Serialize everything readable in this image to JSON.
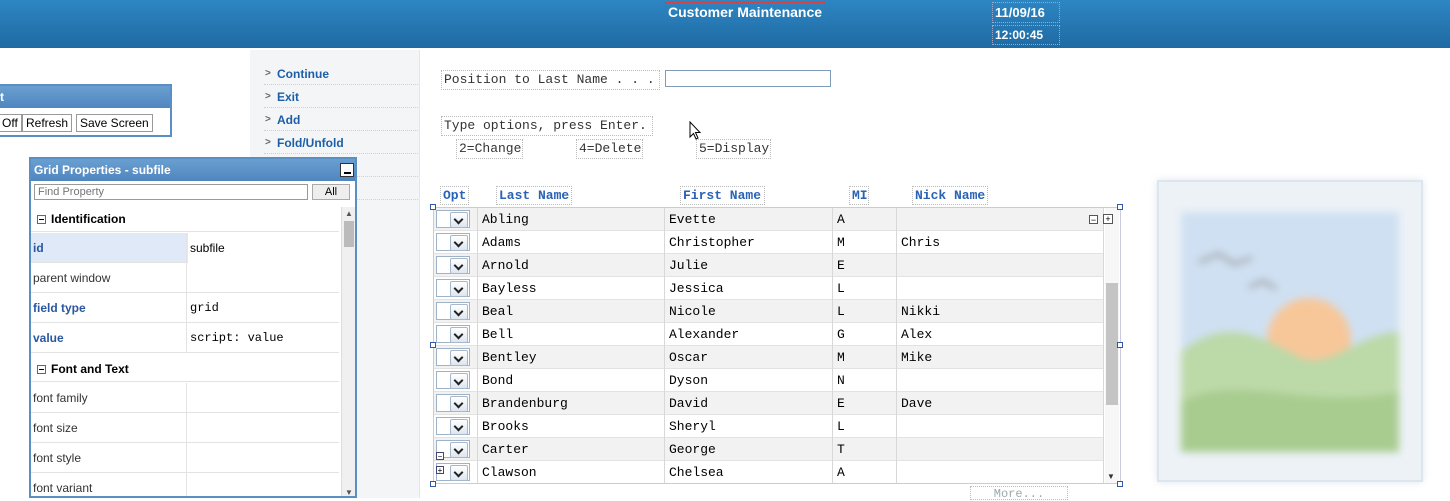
{
  "header": {
    "title": "Customer Maintenance",
    "date": "11/09/16",
    "time": "12:00:45"
  },
  "menu": {
    "items": [
      "Continue",
      "Exit",
      "Add",
      "Fold/Unfold"
    ]
  },
  "toolbar": {
    "title": "t",
    "buttons": [
      "Off",
      "Refresh",
      "Save Screen"
    ]
  },
  "grid_properties": {
    "title": "Grid Properties - subfile",
    "search_placeholder": "Find Property",
    "all_label": "All",
    "sections": [
      {
        "title": "Identification",
        "rows": [
          {
            "name": "id",
            "value": "subfile"
          },
          {
            "name": "parent window",
            "value": ""
          },
          {
            "name": "field type",
            "value": "grid"
          },
          {
            "name": "value",
            "value": "script: value"
          }
        ]
      },
      {
        "title": "Font and Text",
        "rows": [
          {
            "name": "font family",
            "value": ""
          },
          {
            "name": "font size",
            "value": ""
          },
          {
            "name": "font style",
            "value": ""
          },
          {
            "name": "font variant",
            "value": ""
          }
        ]
      }
    ]
  },
  "form": {
    "position_label": "Position to Last Name . . .",
    "position_value": "",
    "instructions": "Type options, press Enter.",
    "options": [
      "2=Change",
      "4=Delete",
      "5=Display"
    ],
    "columns": [
      "Opt",
      "Last Name",
      "First Name",
      "MI",
      "Nick Name"
    ],
    "rows": [
      {
        "last": "Abling",
        "first": "Evette",
        "mi": "A",
        "nick": ""
      },
      {
        "last": "Adams",
        "first": "Christopher",
        "mi": "M",
        "nick": "Chris"
      },
      {
        "last": "Arnold",
        "first": "Julie",
        "mi": "E",
        "nick": ""
      },
      {
        "last": "Bayless",
        "first": "Jessica",
        "mi": "L",
        "nick": ""
      },
      {
        "last": "Beal",
        "first": "Nicole",
        "mi": "L",
        "nick": "Nikki"
      },
      {
        "last": "Bell",
        "first": "Alexander",
        "mi": "G",
        "nick": "Alex"
      },
      {
        "last": "Bentley",
        "first": "Oscar",
        "mi": "M",
        "nick": "Mike"
      },
      {
        "last": "Bond",
        "first": "Dyson",
        "mi": "N",
        "nick": ""
      },
      {
        "last": "Brandenburg",
        "first": "David",
        "mi": "E",
        "nick": "Dave"
      },
      {
        "last": "Brooks",
        "first": "Sheryl",
        "mi": "L",
        "nick": ""
      },
      {
        "last": "Carter",
        "first": "George",
        "mi": "T",
        "nick": ""
      },
      {
        "last": "Clawson",
        "first": "Chelsea",
        "mi": "A",
        "nick": ""
      }
    ],
    "more_label": "More..."
  }
}
